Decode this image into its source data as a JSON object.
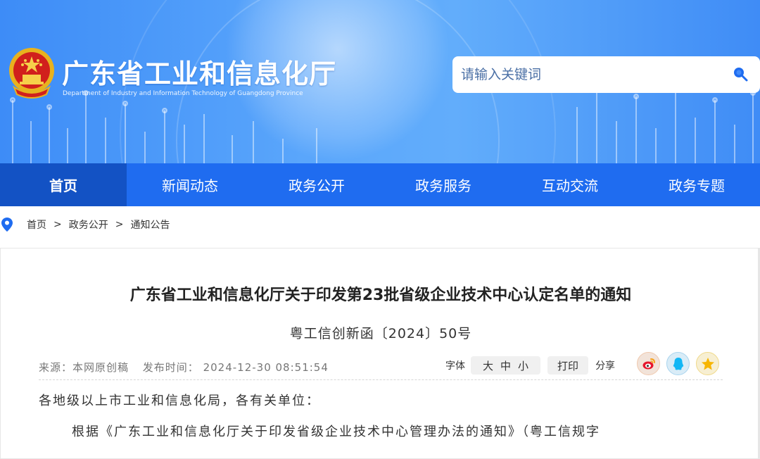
{
  "header": {
    "title": "广东省工业和信息化厅",
    "subtitle": "Department of Industry and Information Technology of Guangdong Province"
  },
  "search": {
    "placeholder": "请输入关键词"
  },
  "nav": {
    "items": [
      {
        "label": "首页",
        "active": true
      },
      {
        "label": "新闻动态",
        "active": false
      },
      {
        "label": "政务公开",
        "active": false
      },
      {
        "label": "政务服务",
        "active": false
      },
      {
        "label": "互动交流",
        "active": false
      },
      {
        "label": "政务专题",
        "active": false
      }
    ]
  },
  "breadcrumb": {
    "items": [
      "首页",
      "政务公开",
      "通知公告"
    ],
    "separator": ">"
  },
  "article": {
    "title": "广东省工业和信息化厅关于印发第23批省级企业技术中心认定名单的通知",
    "doc_number": "粤工信创新函〔2024〕50号",
    "source": "来源：本网原创稿",
    "publish_time": "发布时间：  2024-12-30 08:51:54",
    "font_label": "字体",
    "size_large": "大",
    "size_medium": "中",
    "size_small": "小",
    "print_label": "打印",
    "share_label": "分享",
    "greeting": "各地级以上市工业和信息化局，各有关单位：",
    "paragraph_start": "根据《广东工业和信息化厅关于印发省级企业技术中心管理办法的通知》（粤工信规字"
  },
  "colors": {
    "nav_bg": "#1f6cf0",
    "nav_active_bg": "#1352c4",
    "banner_blue": "#3d8cf7"
  },
  "icons": {
    "emblem": "national-emblem-icon",
    "search": "search-icon",
    "location": "location-pin-icon",
    "weibo": "weibo-icon",
    "qq": "qq-icon",
    "qzone": "qzone-star-icon"
  }
}
